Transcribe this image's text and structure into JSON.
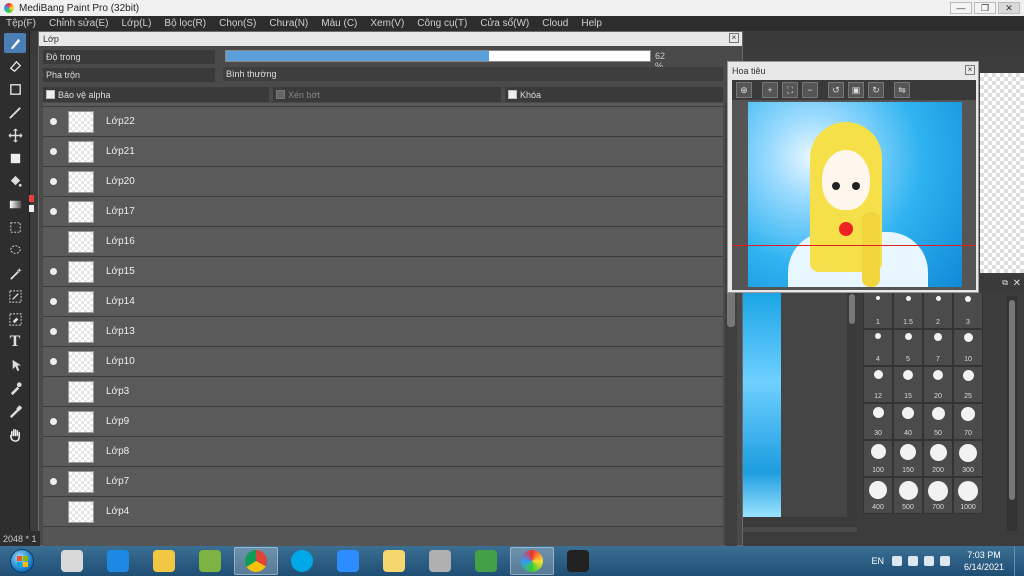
{
  "window": {
    "title": "MediBang Paint Pro (32bit)",
    "controls": [
      "—",
      "❐",
      "✕"
    ]
  },
  "menubar": [
    "Tệp(F)",
    "Chỉnh sửa(E)",
    "Lớp(L)",
    "Bộ lọc(R)",
    "Chọn(S)",
    "Chưa(N)",
    "Màu (C)",
    "Xem(V)",
    "Công cụ(T)",
    "Cửa sổ(W)",
    "Cloud",
    "Help"
  ],
  "tools": [
    "brush-icon",
    "eraser-icon",
    "rectangle-icon",
    "pen-icon",
    "move-icon",
    "fill-rect-icon",
    "bucket-icon",
    "gradient-icon",
    "select-rect-icon",
    "lasso-icon",
    "magic-wand-icon",
    "select-pen-icon",
    "select-eraser-icon",
    "text-icon",
    "operation-icon",
    "eyedropper-icon",
    "dropper-icon",
    "hand-icon"
  ],
  "layer_panel": {
    "title": "Lớp",
    "opacity_label": "Độ trong",
    "opacity_percent": 62,
    "opacity_text": "62 %",
    "blend_label": "Pha trộn",
    "blend_value": "Bình thường",
    "options": {
      "alpha_protect": "Bảo vệ alpha",
      "clipping": "Xén bớt",
      "lock": "Khóa"
    },
    "layers": [
      {
        "name": "Lớp22",
        "visible": true
      },
      {
        "name": "Lớp21",
        "visible": true
      },
      {
        "name": "Lớp20",
        "visible": true
      },
      {
        "name": "Lớp17",
        "visible": true
      },
      {
        "name": "Lớp16",
        "visible": false
      },
      {
        "name": "Lớp15",
        "visible": true
      },
      {
        "name": "Lớp14",
        "visible": true
      },
      {
        "name": "Lớp13",
        "visible": true
      },
      {
        "name": "Lớp10",
        "visible": true
      },
      {
        "name": "Lớp3",
        "visible": false
      },
      {
        "name": "Lớp9",
        "visible": true
      },
      {
        "name": "Lớp8",
        "visible": false
      },
      {
        "name": "Lớp7",
        "visible": true
      },
      {
        "name": "Lớp4",
        "visible": false
      }
    ]
  },
  "navigator": {
    "title": "Hoa tiêu"
  },
  "brush_sizes": [
    "1",
    "1.5",
    "2",
    "3",
    "4",
    "5",
    "7",
    "10",
    "12",
    "15",
    "20",
    "25",
    "30",
    "40",
    "50",
    "70",
    "100",
    "150",
    "200",
    "300",
    "400",
    "500",
    "700",
    "1000"
  ],
  "status": {
    "canvas_size": "2048 * 1"
  },
  "taskbar": {
    "apps": [
      "app-icon",
      "ie-icon",
      "explorer-icon",
      "app-green-icon",
      "chrome-icon",
      "skype-icon",
      "zoom-icon",
      "paint-icon",
      "app-link-icon",
      "app-game-icon",
      "medibang-icon",
      "nox-icon"
    ],
    "language": "EN",
    "time": "7:03 PM",
    "date": "6/14/2021"
  }
}
